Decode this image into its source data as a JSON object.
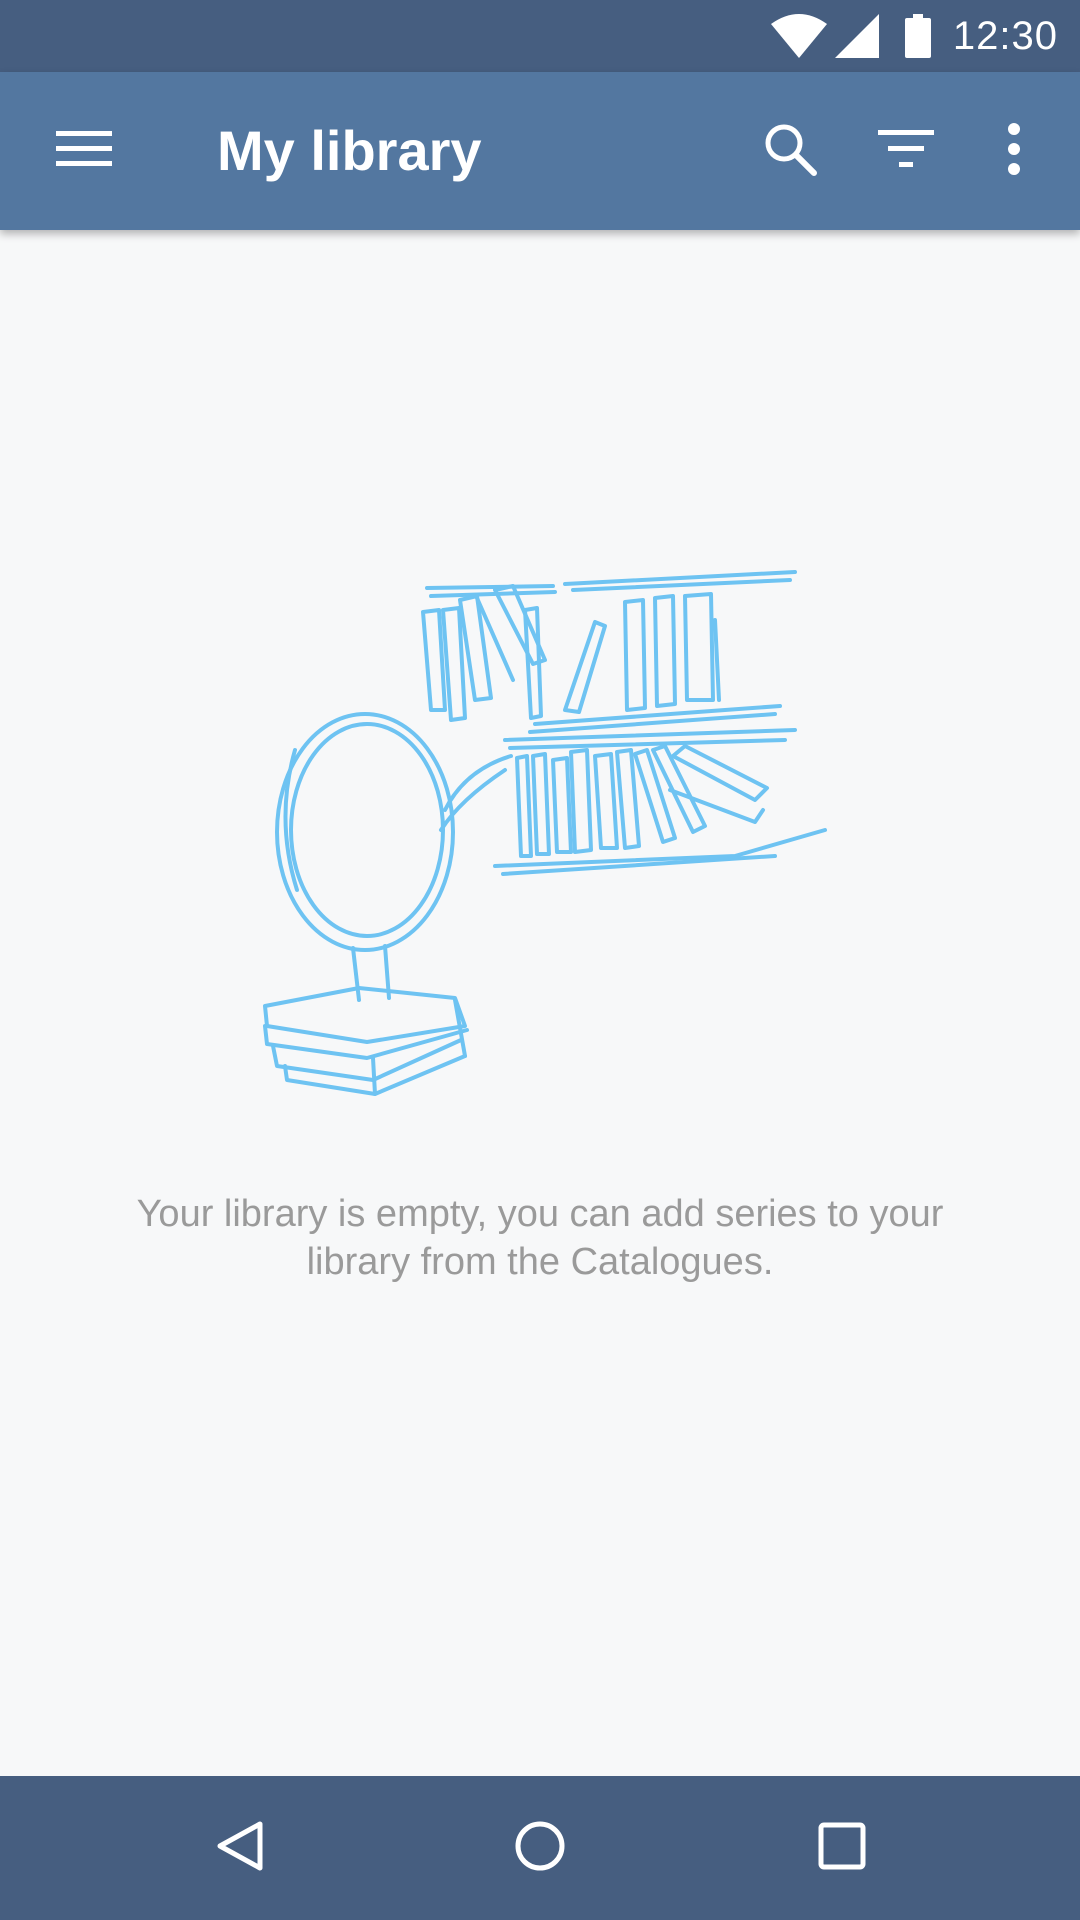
{
  "status_bar": {
    "time": "12:30",
    "icons": [
      "wifi-icon",
      "cell-signal-icon",
      "battery-icon"
    ]
  },
  "app_bar": {
    "title": "My library",
    "icons": [
      "menu-icon",
      "search-icon",
      "filter-icon",
      "more-vert-icon"
    ],
    "color": "#5377a0"
  },
  "empty_state": {
    "illustration": "bookshelf-magnifier-illustration",
    "message": "Your library is empty, you can add series to your library from the Catalogues.",
    "illustration_color": "#6ec3f2"
  },
  "nav_bar": {
    "icons": [
      "back-icon",
      "home-icon",
      "recents-icon"
    ],
    "color": "#465e80"
  }
}
